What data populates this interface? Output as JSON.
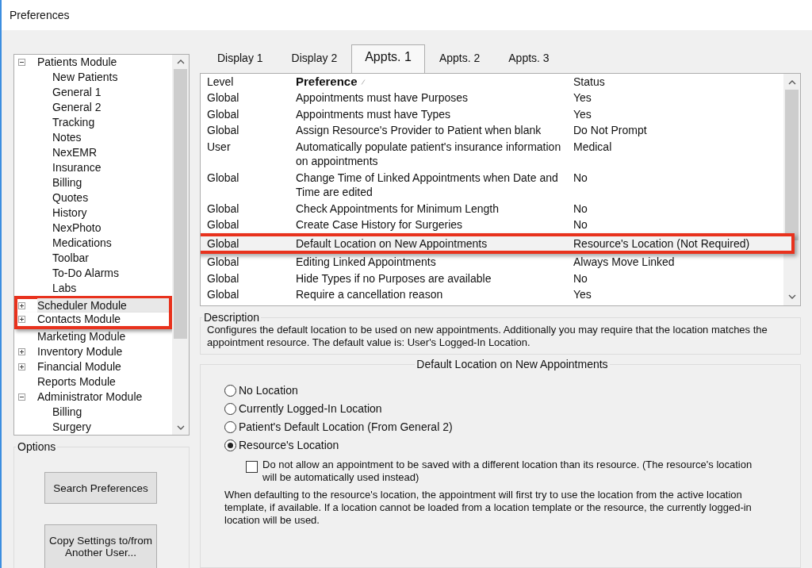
{
  "window": {
    "title": "Preferences"
  },
  "tree": {
    "items": [
      {
        "label": "Patients Module",
        "kind": "branch",
        "expanded": true,
        "highlighted": false,
        "children": [
          {
            "label": "New Patients"
          },
          {
            "label": "General 1"
          },
          {
            "label": "General 2"
          },
          {
            "label": "Tracking"
          },
          {
            "label": "Notes"
          },
          {
            "label": "NexEMR"
          },
          {
            "label": "Insurance"
          },
          {
            "label": "Billing"
          },
          {
            "label": "Quotes"
          },
          {
            "label": "History"
          },
          {
            "label": "NexPhoto"
          },
          {
            "label": "Medications"
          },
          {
            "label": "Toolbar"
          },
          {
            "label": "To-Do Alarms"
          },
          {
            "label": "Labs"
          }
        ]
      },
      {
        "label": "Scheduler Module",
        "kind": "branch",
        "expanded": false,
        "highlighted": true
      },
      {
        "label": "Contacts Module",
        "kind": "branch",
        "expanded": false,
        "highlighted": true
      },
      {
        "label": "Marketing Module",
        "kind": "leaf",
        "highlighted": false
      },
      {
        "label": "Inventory Module",
        "kind": "branch",
        "expanded": false,
        "highlighted": false
      },
      {
        "label": "Financial Module",
        "kind": "branch",
        "expanded": false,
        "highlighted": false
      },
      {
        "label": "Reports Module",
        "kind": "leaf",
        "highlighted": false
      },
      {
        "label": "Administrator Module",
        "kind": "branch",
        "expanded": true,
        "highlighted": false,
        "children": [
          {
            "label": "Billing"
          },
          {
            "label": "Surgery"
          }
        ]
      }
    ]
  },
  "options": {
    "title": "Options",
    "buttons": [
      "Search Preferences",
      "Copy Settings to/from Another User..."
    ]
  },
  "tabs": [
    {
      "label": "Display 1",
      "selected": false
    },
    {
      "label": "Display 2",
      "selected": false
    },
    {
      "label": "Appts. 1",
      "selected": true
    },
    {
      "label": "Appts. 2",
      "selected": false
    },
    {
      "label": "Appts. 3",
      "selected": false
    }
  ],
  "table": {
    "columns": [
      "Level",
      "Preference",
      "Status"
    ],
    "rows": [
      {
        "level": "Global",
        "preference": "Appointments must have Purposes",
        "status": "Yes",
        "highlighted": false
      },
      {
        "level": "Global",
        "preference": "Appointments must have Types",
        "status": "Yes",
        "highlighted": false
      },
      {
        "level": "Global",
        "preference": "Assign Resource's Provider to Patient when blank",
        "status": "Do Not Prompt",
        "highlighted": false
      },
      {
        "level": "User",
        "preference": "Automatically populate patient's insurance information on appointments",
        "status": "Medical",
        "highlighted": false
      },
      {
        "level": "Global",
        "preference": "Change Time of Linked Appointments when Date and Time are edited",
        "status": "No",
        "highlighted": false
      },
      {
        "level": "Global",
        "preference": "Check Appointments for Minimum Length",
        "status": "No",
        "highlighted": false
      },
      {
        "level": "Global",
        "preference": "Create Case History for Surgeries",
        "status": "No",
        "highlighted": false
      },
      {
        "level": "Global",
        "preference": "Default Location on New Appointments",
        "status": "Resource's Location (Not Required)",
        "highlighted": true
      },
      {
        "level": "Global",
        "preference": "Editing Linked Appointments",
        "status": "Always Move Linked",
        "highlighted": false
      },
      {
        "level": "Global",
        "preference": "Hide Types if no Purposes are available",
        "status": "No",
        "highlighted": false
      },
      {
        "level": "Global",
        "preference": "Require a cancellation reason",
        "status": "Yes",
        "highlighted": false
      }
    ]
  },
  "description": {
    "title": "Description",
    "text": "Configures the default location to be used on new appointments. Additionally you may require that the location matches the appointment resource.  The default value is: User's Logged-In Location."
  },
  "setting": {
    "title": "Default Location on New Appointments",
    "choices": [
      {
        "label": "No Location",
        "selected": false
      },
      {
        "label": "Currently Logged-In Location",
        "selected": false
      },
      {
        "label": "Patient's Default Location (From General 2)",
        "selected": false
      },
      {
        "label": "Resource's Location",
        "selected": true
      }
    ],
    "checkbox": {
      "label": "Do not allow an appointment to be saved with a different location than its resource. (The resource's location will be automatically used instead)",
      "checked": false
    },
    "note": "When defaulting to the resource's location, the appointment will first try to use the location from the active location template, if available. If a location cannot be loaded from a location template or the resource, the currently logged-in location will be used."
  }
}
